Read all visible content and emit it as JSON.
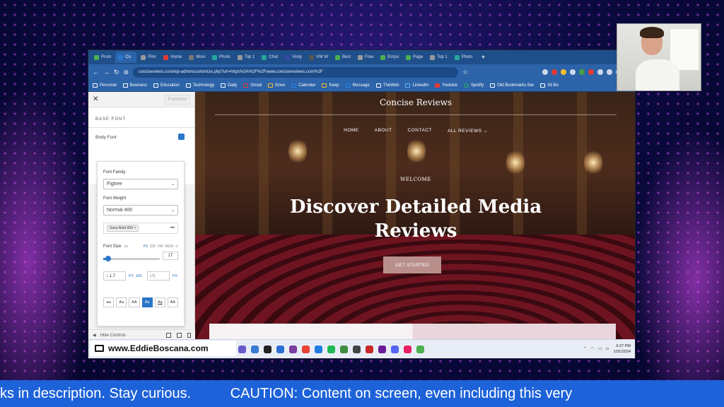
{
  "browser": {
    "tabs": [
      "Prom",
      "Co",
      "Film",
      "Home",
      "Movi",
      "Photo",
      "Top 1",
      "Chat",
      "Visily",
      "VW W",
      "Best",
      "Free",
      "Empo",
      "Page",
      "Top 1",
      "Photo"
    ],
    "url": "conciseviews.com/wp-admin/customize.php?url=https%3A%2F%2Fwww.concisereviews.com%2F",
    "bookmarks": [
      "Personal",
      "Business",
      "Education",
      "Technology",
      "Daily",
      "Gmail",
      "Drive",
      "Calendar",
      "Keep",
      "Message",
      "TheWeb",
      "LinkedIn",
      "Youtube",
      "Spotify",
      "Old Bookmarks Bar",
      "All Bo"
    ]
  },
  "customizer": {
    "close": "✕",
    "published": "Published",
    "section": "BASE FONT",
    "body_font": "Body Font",
    "font_family_label": "Font Family",
    "font_family_value": "Figtree",
    "font_weight_label": "Font Weight",
    "font_weight_value": "Normal 400",
    "variant_chip": "Sans-Bold 600",
    "font_size_label": "Font Size",
    "size_units": [
      "PX",
      "EM",
      "VW",
      "REM"
    ],
    "font_size_value": "17",
    "line_height_value": "1.7",
    "line_height_units": [
      "PX",
      "EM"
    ],
    "letter_spacing_placeholder": "[A]",
    "letter_spacing_unit": "PX",
    "case_options": [
      "aa",
      "Aa",
      "AA",
      "Aa",
      "Aa",
      "AA"
    ],
    "hide_controls": "Hide Controls"
  },
  "site": {
    "title": "Concise Reviews",
    "nav": [
      "HOME",
      "ABOUT",
      "CONTACT",
      "ALL REVIEWS ⌄"
    ],
    "welcome": "WELCOME",
    "hero_line1": "Discover Detailed Media",
    "hero_line2": "Reviews",
    "cta": "GET STARTED"
  },
  "taskbar": {
    "time": "6:27 PM",
    "date": "1/31/2024",
    "app_colors": [
      "#6a5acd",
      "#3a7bd5",
      "#222222",
      "#2b6fd6",
      "#7b3fa0",
      "#e94235",
      "#1e7be0",
      "#1db954",
      "#3c8d40",
      "#444444",
      "#c62828",
      "#6a1b9a",
      "#5865f2",
      "#e91e63",
      "#4caf50"
    ]
  },
  "brand": "www.EddieBoscana.com",
  "ticker": "ks in description. Stay curious.          CAUTION: Content on screen, even including this very"
}
